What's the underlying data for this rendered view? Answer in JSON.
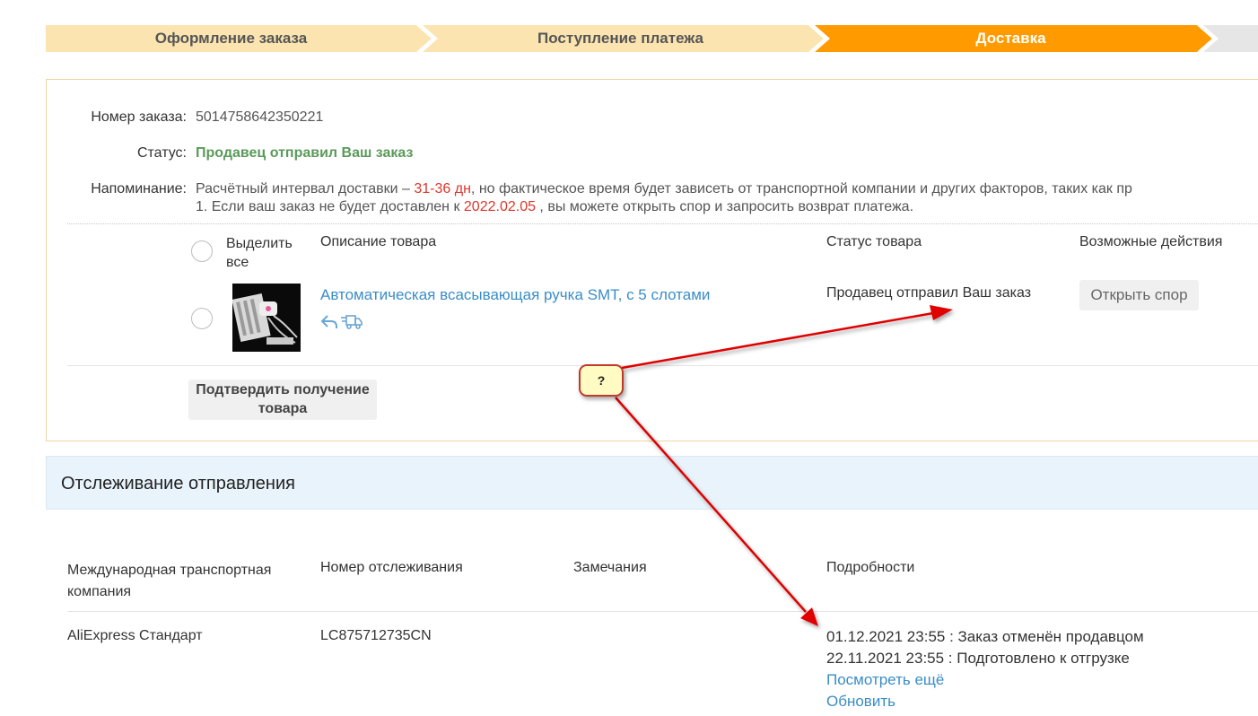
{
  "steps": [
    {
      "label": "Оформление заказа",
      "state": "done"
    },
    {
      "label": "Поступление платежа",
      "state": "done"
    },
    {
      "label": "Доставка",
      "state": "active"
    }
  ],
  "colors": {
    "step_done": "#fbe4b0",
    "step_active": "#ff9b00",
    "step_pending": "#e6e6e6",
    "accent_red": "#e0352b",
    "status_green": "#5a9a5a",
    "link_blue": "#3a8dc7"
  },
  "order": {
    "number_label": "Номер заказа:",
    "number_value": "5014758642350221",
    "status_label": "Статус:",
    "status_value": "Продавец отправил Ваш заказ",
    "reminder_label": "Напоминание:",
    "reminder_line1_a": "Расчётный интервал доставки – ",
    "reminder_line1_days": "31-36 дн",
    "reminder_line1_b": ", но фактическое время будет зависеть от транспортной компании и других факторов, таких как пр",
    "reminder_line2_a": "1. Если ваш заказ не будет доставлен к ",
    "reminder_line2_date": "2022.02.05",
    "reminder_line2_b": " , вы можете открыть спор и запросить возврат платежа."
  },
  "items_table": {
    "select_all": "Выделить все",
    "col_description": "Описание товара",
    "col_status": "Статус товара",
    "col_actions": "Возможные действия",
    "item": {
      "title": "Автоматическая всасывающая ручка SMT, с 5 слотами",
      "status": "Продавец отправил Ваш заказ",
      "action": "Открыть спор",
      "icons": [
        "return-arrow-icon",
        "delivery-truck-icon"
      ]
    },
    "confirm_button": "Подтвердить получение товара"
  },
  "tracking": {
    "title": "Отслеживание отправления",
    "col_company": "Международная транспортная компания",
    "col_number": "Номер отслеживания",
    "col_remarks": "Замечания",
    "col_details": "Подробности",
    "row": {
      "company": "AliExpress Стандарт",
      "number": "LC875712735CN",
      "remarks": "",
      "events": [
        "01.12.2021 23:55 : Заказ отменён продавцом",
        "22.11.2021 23:55 : Подготовлено к отгрузке"
      ],
      "more_link": "Посмотреть ещё",
      "refresh_link": "Обновить"
    }
  },
  "annotation": {
    "bubble_text": "?"
  }
}
